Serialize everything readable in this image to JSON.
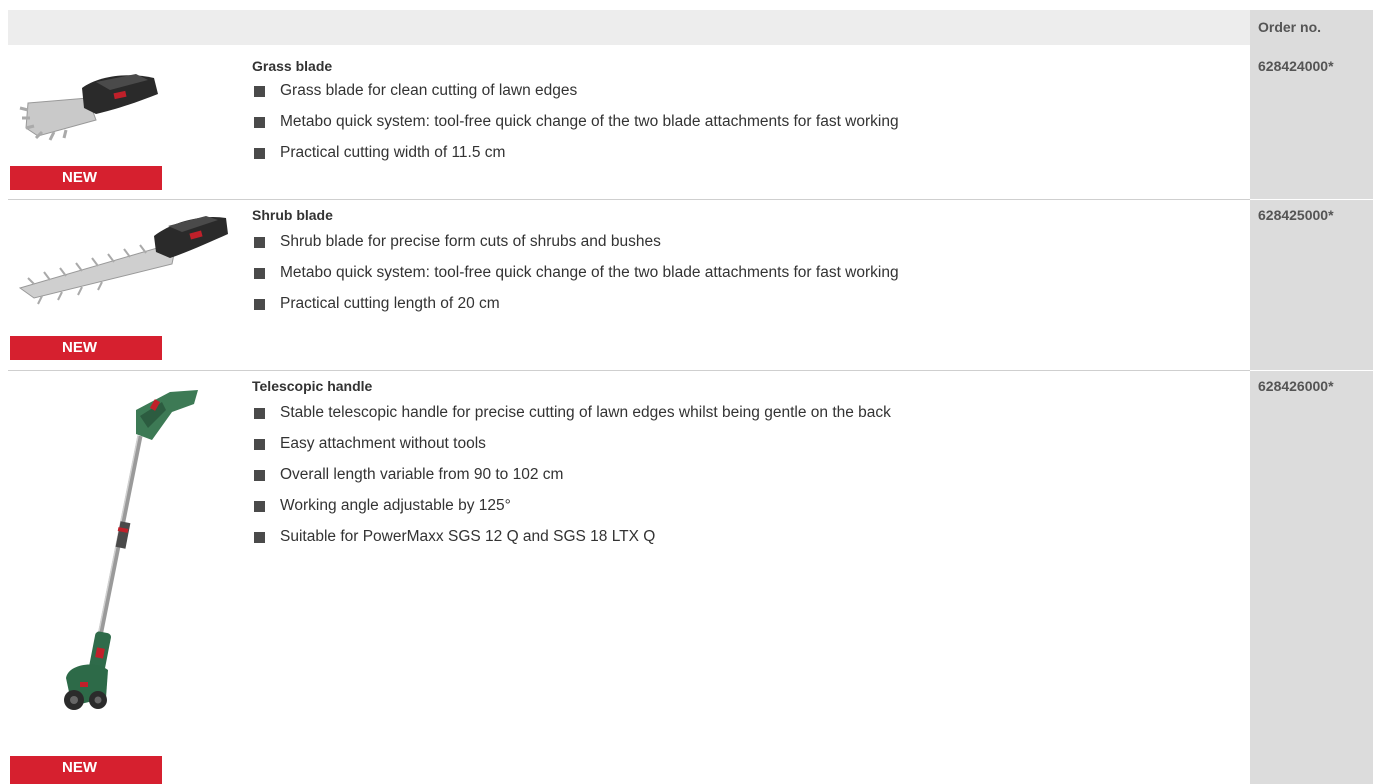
{
  "table": {
    "order_header": "Order no."
  },
  "products": [
    {
      "title": "Grass blade",
      "bullets": [
        "Grass blade for clean cutting of lawn edges",
        "Metabo quick system: tool-free quick change of the two blade attachments for fast working",
        "Practical cutting width of 11.5 cm"
      ],
      "badge": "NEW",
      "order_no": "628424000*"
    },
    {
      "title": "Shrub blade",
      "bullets": [
        "Shrub blade for precise form cuts of shrubs and bushes",
        "Metabo quick system: tool-free quick change of the two blade attachments for fast working",
        "Practical cutting length of 20 cm"
      ],
      "badge": "NEW",
      "order_no": "628425000*"
    },
    {
      "title": "Telescopic handle",
      "bullets": [
        "Stable telescopic handle for precise cutting of lawn edges whilst being gentle on the back",
        "Easy attachment without tools",
        "Overall length variable from 90 to 102 cm",
        "Working angle adjustable by 125°",
        "Suitable for PowerMaxx SGS 12 Q and SGS 18 LTX Q"
      ],
      "badge": "NEW",
      "order_no": "628426000*"
    }
  ],
  "colors": {
    "badge_red": "#d6202f",
    "header_gray": "#ededed",
    "order_col_gray": "#dcdcdc"
  }
}
